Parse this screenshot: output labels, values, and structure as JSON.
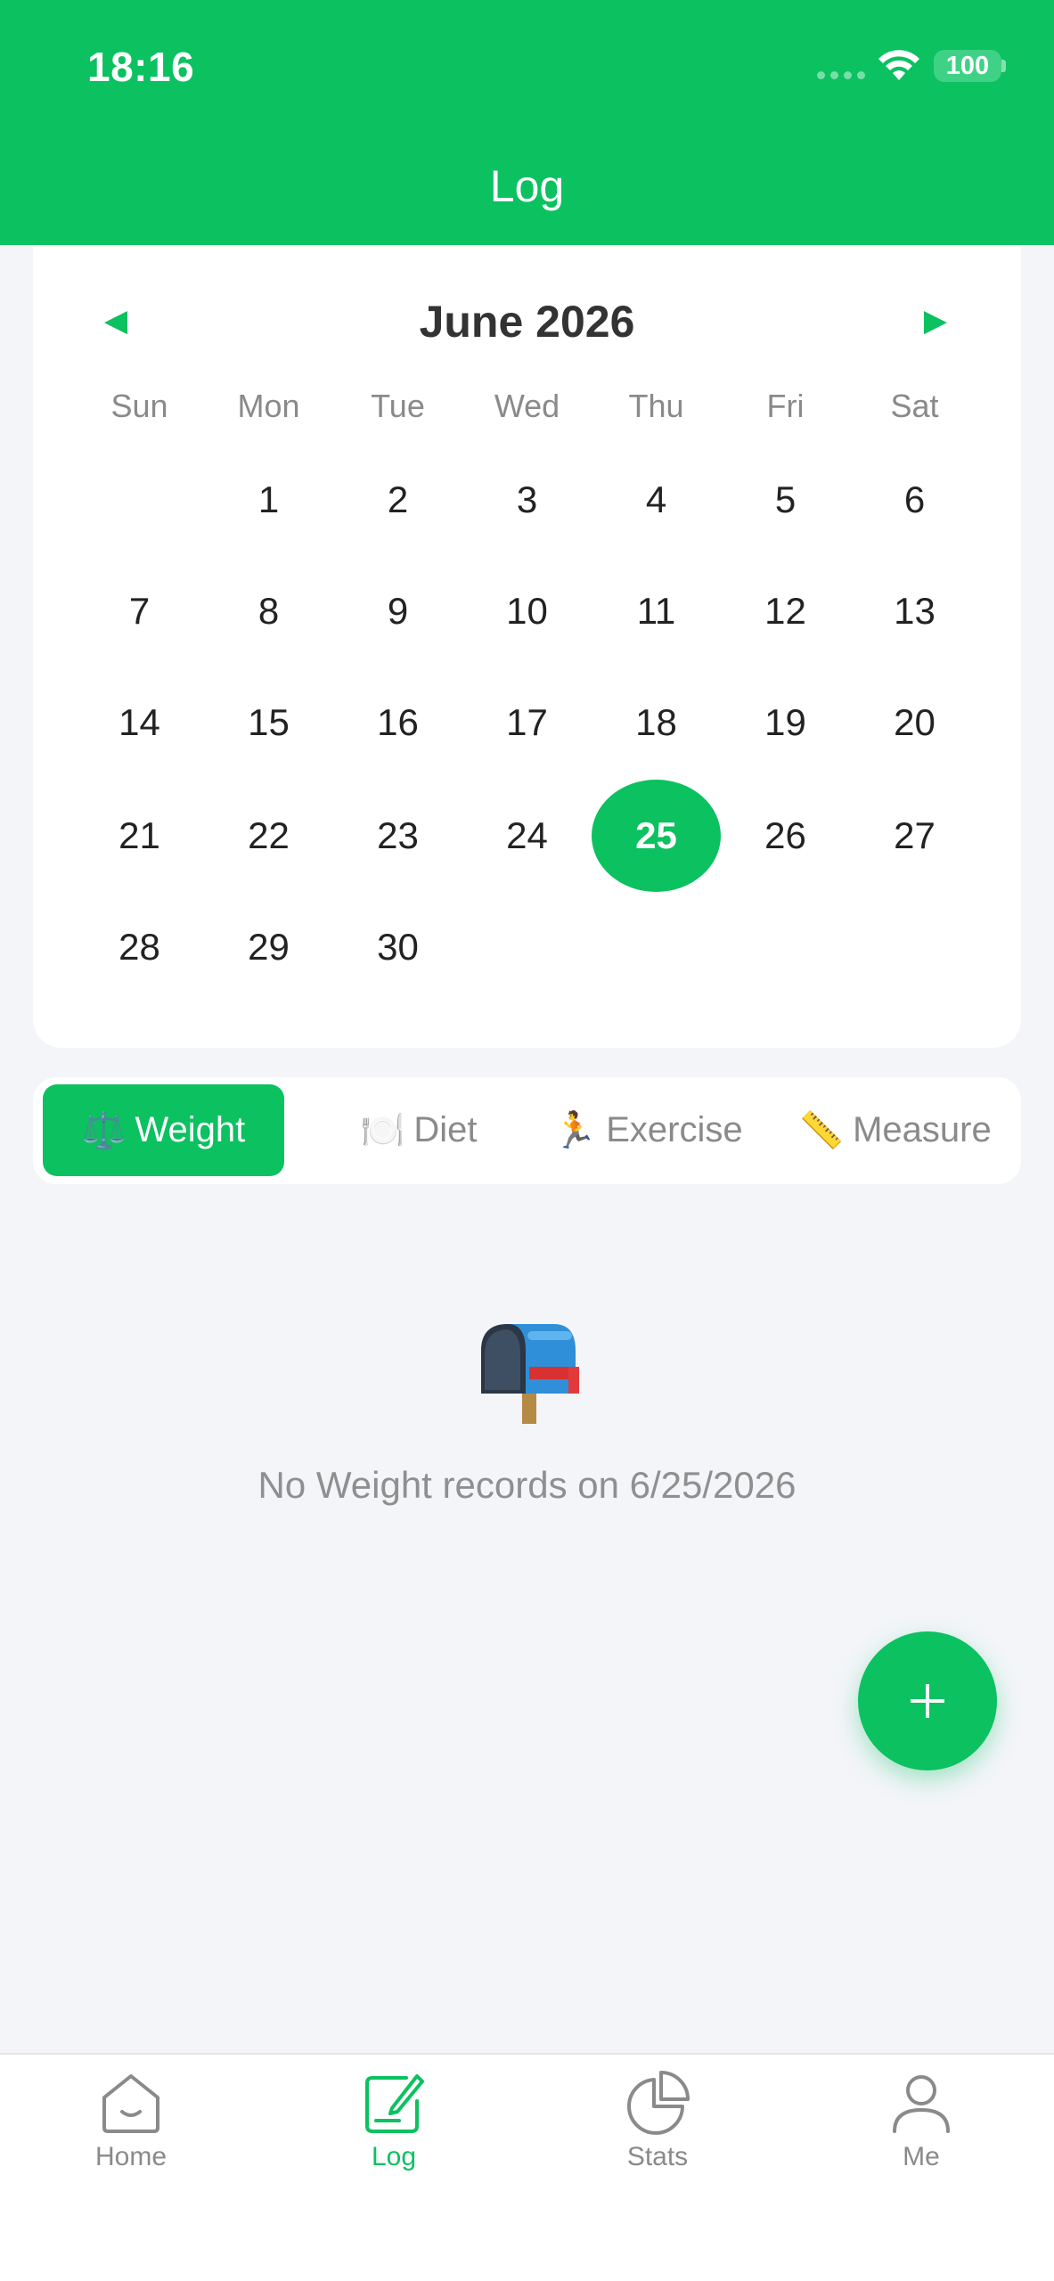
{
  "status_bar": {
    "time": "18:16",
    "battery": "100"
  },
  "header": {
    "title": "Log"
  },
  "calendar": {
    "month_label": "June 2026",
    "prev_label": "◀",
    "next_label": "▶",
    "weekdays": [
      "Sun",
      "Mon",
      "Tue",
      "Wed",
      "Thu",
      "Fri",
      "Sat"
    ],
    "days": [
      "1",
      "2",
      "3",
      "4",
      "5",
      "6",
      "7",
      "8",
      "9",
      "10",
      "11",
      "12",
      "13",
      "14",
      "15",
      "16",
      "17",
      "18",
      "19",
      "20",
      "21",
      "22",
      "23",
      "24",
      "25",
      "26",
      "27",
      "28",
      "29",
      "30"
    ],
    "selected_day": "25",
    "accent": "#0bc160"
  },
  "tabs": [
    {
      "emoji": "⚖️",
      "label": "Weight",
      "active": true
    },
    {
      "emoji": "🍽️",
      "label": "Diet",
      "active": false
    },
    {
      "emoji": "🏃",
      "label": "Exercise",
      "active": false
    },
    {
      "emoji": "📏",
      "label": "Measure",
      "active": false
    }
  ],
  "empty_state": {
    "icon": "mailbox-icon",
    "text": "No Weight records on 6/25/2026"
  },
  "fab": {
    "icon": "plus-icon"
  },
  "bottom_nav": [
    {
      "label": "Home",
      "icon": "home-icon",
      "active": false
    },
    {
      "label": "Log",
      "icon": "log-icon",
      "active": true
    },
    {
      "label": "Stats",
      "icon": "stats-icon",
      "active": false
    },
    {
      "label": "Me",
      "icon": "profile-icon",
      "active": false
    }
  ]
}
